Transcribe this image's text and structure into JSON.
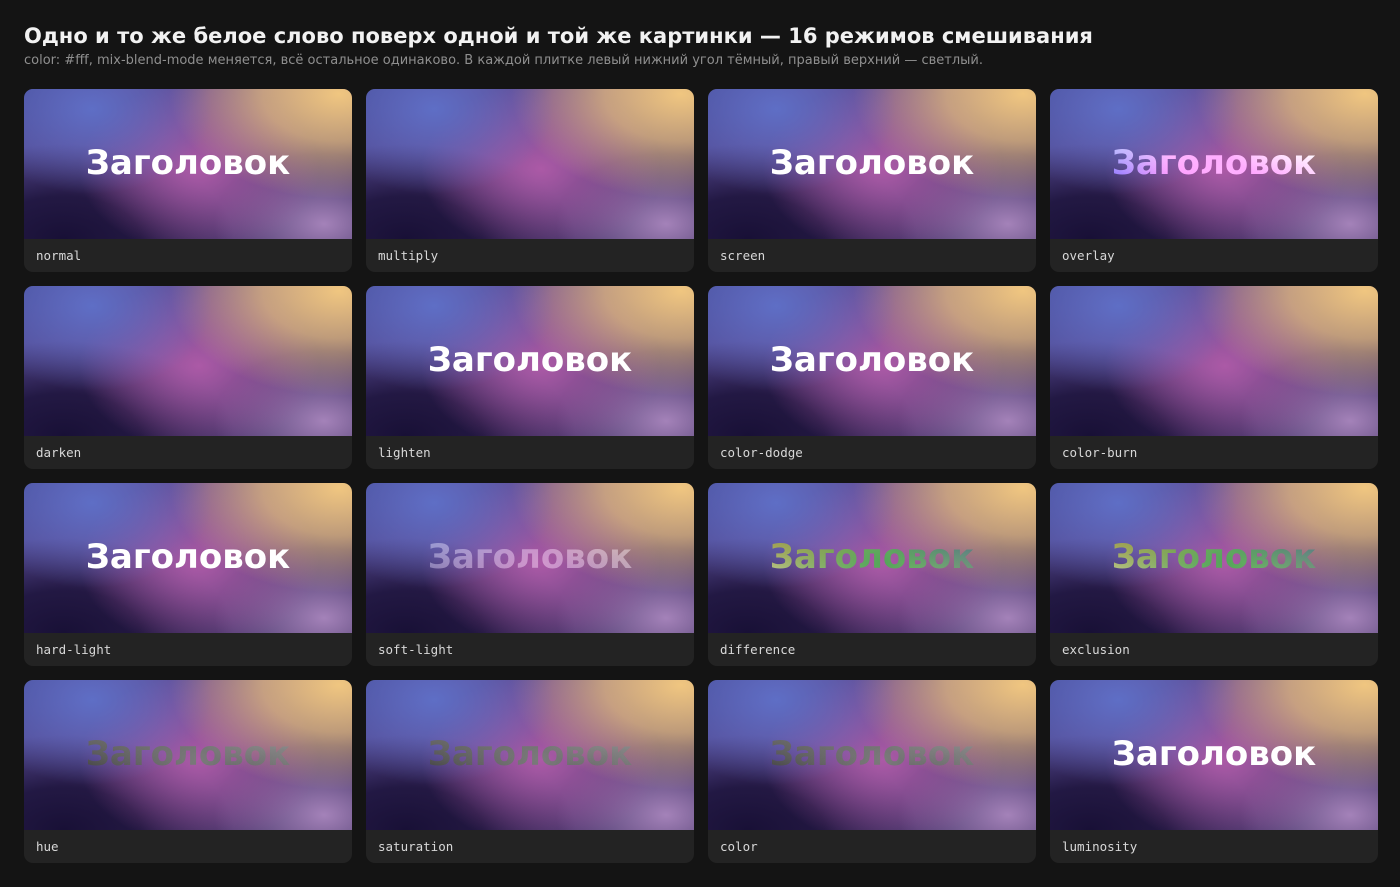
{
  "title": "Одно и то же белое слово поверх одной и той же картинки — 16 режимов смешивания",
  "subtitle": "color: #fff, mix-blend-mode меняется, всё остальное одинаково. В каждой плитке левый нижний угол тёмный, правый верхний — светлый.",
  "word": "Заголовок",
  "word_color": "#ffffff",
  "tiles": [
    {
      "mode": "normal"
    },
    {
      "mode": "multiply"
    },
    {
      "mode": "screen"
    },
    {
      "mode": "overlay"
    },
    {
      "mode": "darken"
    },
    {
      "mode": "lighten"
    },
    {
      "mode": "color-dodge"
    },
    {
      "mode": "color-burn"
    },
    {
      "mode": "hard-light"
    },
    {
      "mode": "soft-light"
    },
    {
      "mode": "difference"
    },
    {
      "mode": "exclusion"
    },
    {
      "mode": "hue"
    },
    {
      "mode": "saturation"
    },
    {
      "mode": "color"
    },
    {
      "mode": "luminosity"
    }
  ]
}
